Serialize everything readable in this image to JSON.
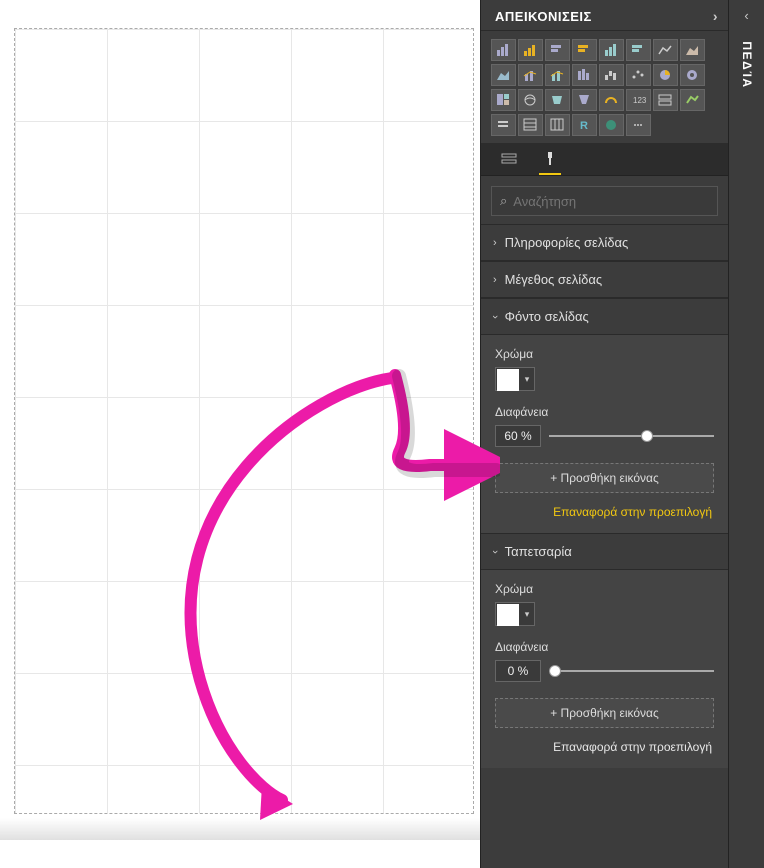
{
  "panel": {
    "visualizations_title": "ΑΠΕΙΚΟΝΙΣΕΙΣ",
    "fields_title": "ΠΕΔΊΑ"
  },
  "search": {
    "placeholder": "Αναζήτηση"
  },
  "sections": {
    "page_info": "Πληροφορίες σελίδας",
    "page_size": "Μέγεθος σελίδας",
    "page_background": "Φόντο σελίδας",
    "wallpaper": "Ταπετσαρία"
  },
  "labels": {
    "color": "Χρώμα",
    "transparency": "Διαφάνεια",
    "add_image": "+ Προσθήκη εικόνας",
    "reset_default": "Επαναφορά στην προεπιλογή"
  },
  "pageBackground": {
    "color": "#FFFFFF",
    "transparency": 60,
    "transparency_display": "60  %"
  },
  "wallpaper": {
    "color": "#FFFFFF",
    "transparency": 0,
    "transparency_display": "0   %"
  }
}
